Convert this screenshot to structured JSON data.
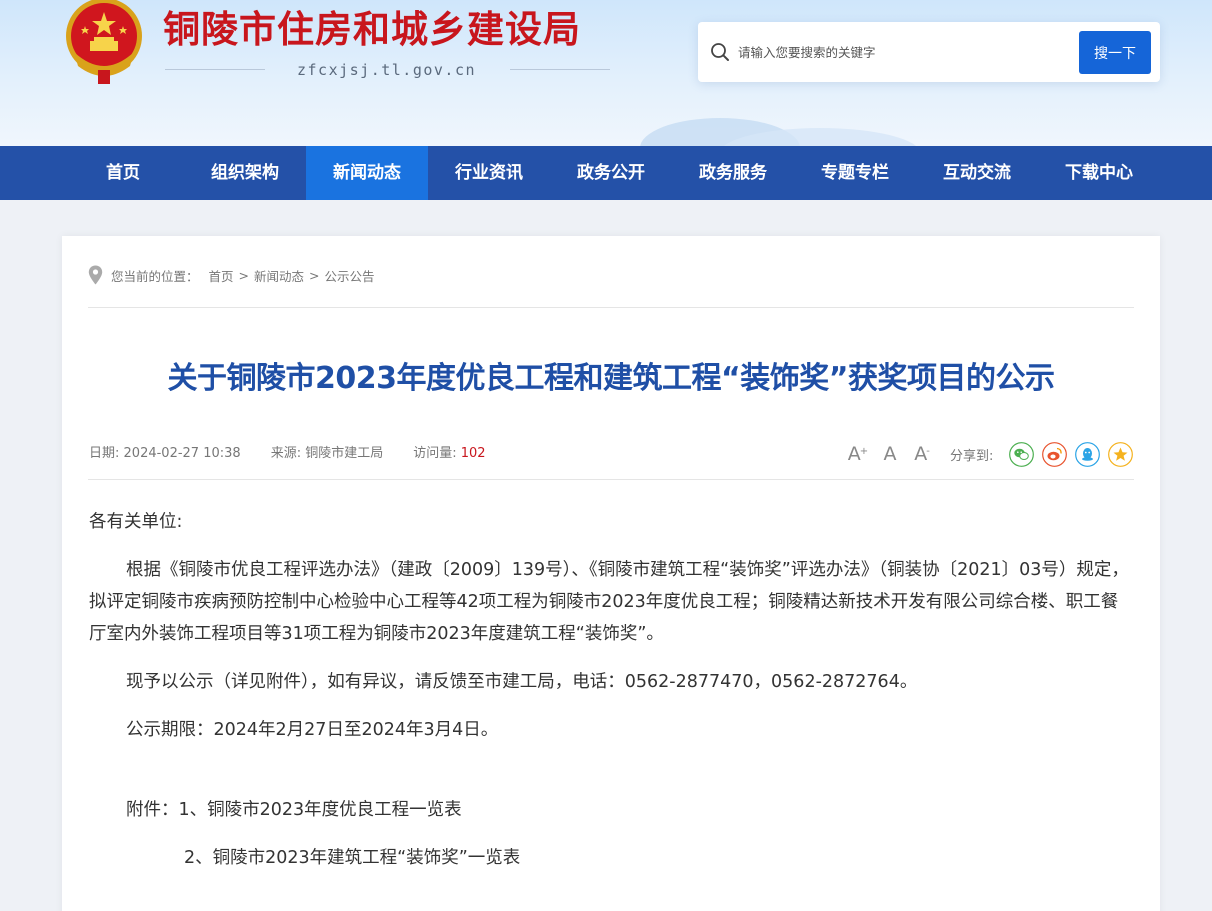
{
  "header": {
    "site_title": "铜陵市住房和城乡建设局",
    "site_domain": "zfcxjsj.tl.gov.cn",
    "title_color": "#c8161d"
  },
  "search": {
    "placeholder": "请输入您要搜索的关键字",
    "button_label": "搜一下",
    "icon": "search-icon",
    "button_color": "#1565d8"
  },
  "nav": {
    "bg_color": "#2451a8",
    "active_color": "#1a73e0",
    "items": [
      {
        "label": "首页"
      },
      {
        "label": "组织架构"
      },
      {
        "label": "新闻动态",
        "active": true
      },
      {
        "label": "行业资讯"
      },
      {
        "label": "政务公开"
      },
      {
        "label": "政务服务"
      },
      {
        "label": "专题专栏"
      },
      {
        "label": "互动交流"
      },
      {
        "label": "下载中心"
      }
    ]
  },
  "breadcrumb": {
    "prefix": "您当前的位置：",
    "items": [
      "首页",
      "新闻动态",
      "公示公告"
    ],
    "separator": ">",
    "icon": "location-pin-icon"
  },
  "article": {
    "title": "关于铜陵市2023年度优良工程和建筑工程“装饰奖”获奖项目的公示",
    "title_color": "#1f4fa6",
    "meta": {
      "date_label": "日期:",
      "date_value": "2024-02-27 10:38",
      "source_label": "来源:",
      "source_value": "铜陵市建工局",
      "views_label": "访问量:",
      "views_value": "102"
    },
    "font_controls": {
      "increase": "A",
      "increase_mark": "+",
      "normal": "A",
      "decrease": "A",
      "decrease_mark": "-"
    },
    "share": {
      "label": "分享到:",
      "targets": [
        {
          "icon": "wechat-icon",
          "color": "#4caf50"
        },
        {
          "icon": "weibo-icon",
          "color": "#e8542f"
        },
        {
          "icon": "qq-icon",
          "color": "#2ba4e6"
        },
        {
          "icon": "qzone-icon",
          "color": "#f5b21e"
        }
      ]
    },
    "paragraphs": {
      "greeting": "各有关单位:",
      "p1": "根据《铜陵市优良工程评选办法》（建政〔2009〕139号）、《铜陵市建筑工程“装饰奖”评选办法》（铜装协〔2021〕03号）规定，拟评定铜陵市疾病预防控制中心检验中心工程等42项工程为铜陵市2023年度优良工程；铜陵精达新技术开发有限公司综合楼、职工餐厅室内外装饰工程项目等31项工程为铜陵市2023年度建筑工程“装饰奖”。",
      "p2": "现予以公示（详见附件），如有异议，请反馈至市建工局，电话：0562-2877470，0562-2872764。",
      "p3": "公示期限：2024年2月27日至2024年3月4日。",
      "attach1": "附件：1、铜陵市2023年度优良工程一览表",
      "attach2": "2、铜陵市2023年建筑工程“装饰奖”一览表"
    }
  }
}
